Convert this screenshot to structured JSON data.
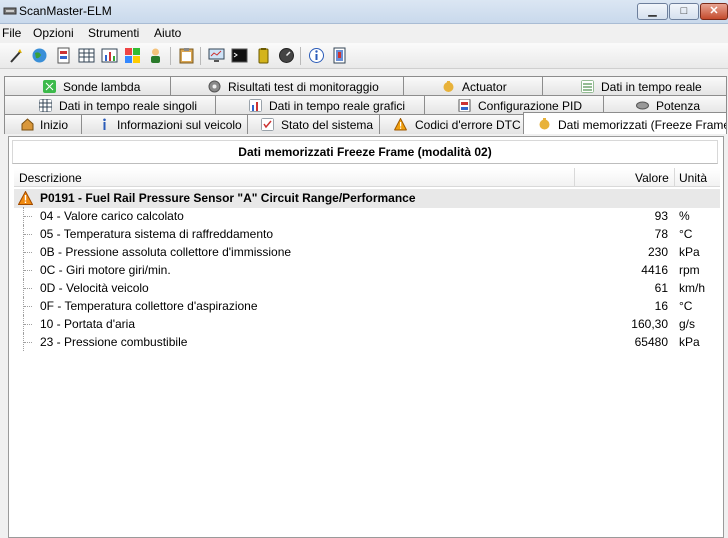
{
  "window": {
    "title": "ScanMaster-ELM",
    "min_label": "▁",
    "max_label": "□",
    "close_label": "✕"
  },
  "menu": [
    "File",
    "Opzioni",
    "Strumenti",
    "Aiuto"
  ],
  "toolbar_icons": [
    "wand-icon",
    "globe-icon",
    "chip-icon",
    "grid-icon",
    "chart-icon",
    "windows-icon",
    "person-icon",
    "clipboard-icon",
    "monitor-icon",
    "terminal-icon",
    "battery-icon",
    "gauge-icon",
    "info-icon",
    "report-icon"
  ],
  "tabs": {
    "row1": [
      "Sonde lambda",
      "Risultati test di monitoraggio",
      "Actuator",
      "Dati in tempo reale"
    ],
    "row2": [
      "Dati in tempo reale singoli",
      "Dati in tempo reale grafici",
      "Configurazione PID",
      "Potenza"
    ],
    "row3": [
      "Inizio",
      "Informazioni sul veicolo",
      "Stato del sistema",
      "Codici d'errore DTC",
      "Dati memorizzati (Freeze Frame)"
    ]
  },
  "panel": {
    "title": "Dati memorizzati Freeze Frame (modalità 02)",
    "columns": {
      "description": "Descrizione",
      "value": "Valore",
      "unit": "Unità"
    },
    "dtc": "P0191 - Fuel Rail Pressure Sensor \"A\" Circuit Range/Performance",
    "rows": [
      {
        "desc": "04 - Valore carico calcolato",
        "value": "93",
        "unit": "%"
      },
      {
        "desc": "05 - Temperatura sistema di raffreddamento",
        "value": "78",
        "unit": "°C"
      },
      {
        "desc": "0B - Pressione assoluta collettore d'immissione",
        "value": "230",
        "unit": "kPa"
      },
      {
        "desc": "0C - Giri motore giri/min.",
        "value": "4416",
        "unit": "rpm"
      },
      {
        "desc": "0D - Velocità veicolo",
        "value": "61",
        "unit": "km/h"
      },
      {
        "desc": "0F - Temperatura collettore d'aspirazione",
        "value": "16",
        "unit": "°C"
      },
      {
        "desc": "10 - Portata d'aria",
        "value": "160,30",
        "unit": "g/s"
      },
      {
        "desc": "23 - Pressione combustibile",
        "value": "65480",
        "unit": "kPa"
      }
    ]
  }
}
